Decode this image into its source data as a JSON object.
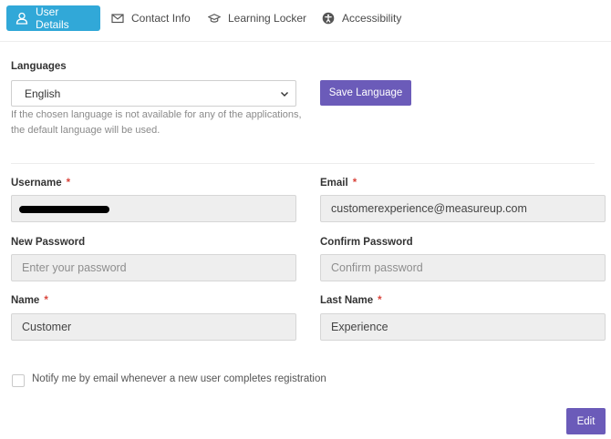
{
  "tabs": [
    {
      "label": "User Details",
      "icon": "user-icon",
      "active": true
    },
    {
      "label": "Contact Info",
      "icon": "mail-icon",
      "active": false
    },
    {
      "label": "Learning Locker",
      "icon": "graduation-cap-icon",
      "active": false
    },
    {
      "label": "Accessibility",
      "icon": "accessibility-icon",
      "active": false
    }
  ],
  "languages": {
    "label": "Languages",
    "selected": "English",
    "save_label": "Save Language",
    "help": "If the chosen language is not available for any of the applications, the default language will be used."
  },
  "form": {
    "username": {
      "label": "Username",
      "required_mark": "*",
      "value": ""
    },
    "email": {
      "label": "Email",
      "required_mark": "*",
      "value": "customerexperience@measureup.com"
    },
    "new_password": {
      "label": "New Password",
      "placeholder": "Enter your password"
    },
    "confirm_password": {
      "label": "Confirm Password",
      "placeholder": "Confirm password"
    },
    "name": {
      "label": "Name",
      "required_mark": "*",
      "value": "Customer"
    },
    "last_name": {
      "label": "Last Name",
      "required_mark": "*",
      "value": "Experience"
    }
  },
  "notify": {
    "label": "Notify me by email whenever a new user completes registration",
    "checked": false
  },
  "edit_label": "Edit",
  "colors": {
    "accent": "#31a8d8",
    "button": "#6b5bb9",
    "required": "#d9453c"
  }
}
